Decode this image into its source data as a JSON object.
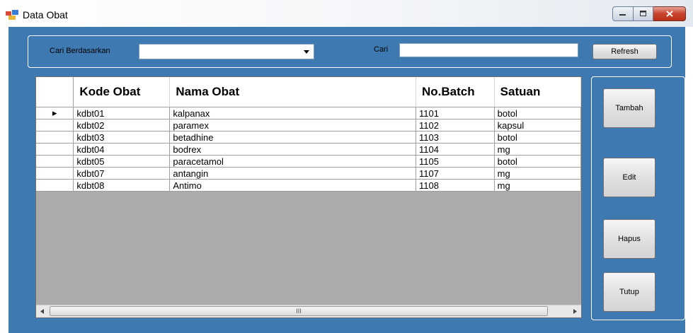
{
  "window": {
    "title": "Data Obat"
  },
  "search": {
    "filter_label": "Cari Berdasarkan",
    "filter_value": "",
    "search_label": "Cari",
    "search_value": "",
    "refresh_label": "Refresh"
  },
  "grid": {
    "columns": [
      "Kode Obat",
      "Nama Obat",
      "No.Batch",
      "Satuan"
    ],
    "rows": [
      [
        "kdbt01",
        "kalpanax",
        "1101",
        "botol"
      ],
      [
        "kdbt02",
        "paramex",
        "1102",
        "kapsul"
      ],
      [
        "kdbt03",
        "betadhine",
        "1103",
        "botol"
      ],
      [
        "kdbt04",
        "bodrex",
        "1104",
        "mg"
      ],
      [
        "kdbt05",
        "paracetamol",
        "1105",
        "botol"
      ],
      [
        "kdbt07",
        "antangin",
        "1107",
        "mg"
      ],
      [
        "kdbt08",
        "Antimo",
        "1108",
        "mg"
      ]
    ],
    "current_row_marker": "▸",
    "scroll_grip": "III"
  },
  "actions": {
    "tambah": "Tambah",
    "edit": "Edit",
    "hapus": "Hapus",
    "tutup": "Tutup"
  },
  "colors": {
    "form_background": "#3f79b1",
    "grid_empty": "#ababab"
  }
}
